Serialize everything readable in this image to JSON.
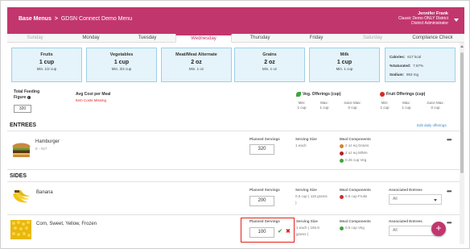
{
  "header": {
    "crumb_root": "Base Menus",
    "crumb_sep": ">",
    "crumb_current": "GDSN Connect Demo Menu",
    "user_name": "Jennifer Frank",
    "user_line2": "Classic Demo ONLY District",
    "user_line3": "District Administrator"
  },
  "tabs": [
    {
      "label": "Sunday"
    },
    {
      "label": "Monday"
    },
    {
      "label": "Tuesday"
    },
    {
      "label": "Wednesday"
    },
    {
      "label": "Thursday"
    },
    {
      "label": "Friday"
    },
    {
      "label": "Saturday"
    },
    {
      "label": "Compliance Check"
    }
  ],
  "cards": [
    {
      "title": "Fruits",
      "value": "1 cup",
      "min": "Min. 1/2 cup"
    },
    {
      "title": "Vegetables",
      "value": "1 cup",
      "min": "Min. 3/4 cup"
    },
    {
      "title": "Meat/Meat Alternate",
      "value": "2 oz",
      "min": "Min. 1 oz"
    },
    {
      "title": "Grains",
      "value": "2 oz",
      "min": "Min. 1 oz"
    },
    {
      "title": "Milk",
      "value": "1 cup",
      "min": "Min. 1 cup"
    }
  ],
  "summary": {
    "calories_label": "Calories:",
    "calories_value": "617 kcal",
    "saturated_label": "%Saturated:",
    "saturated_value": "7.67%",
    "sodium_label": "Sodium:",
    "sodium_value": "953 mg"
  },
  "feeding": {
    "label_line1": "Total Feeding",
    "label_line2": "Figure",
    "value": "320",
    "avg_cost_label": "Avg Cost per Meal",
    "cost_note": "Item Costs Missing"
  },
  "veg_offerings": {
    "title": "Veg. Offerings (cup)",
    "cols": [
      {
        "head": "Min:",
        "val": "1 cup"
      },
      {
        "head": "Max:",
        "val": "1 cup"
      },
      {
        "head": "Juice Max:",
        "val": "0 cup"
      }
    ]
  },
  "fruit_offerings": {
    "title": "Fruit Offerings (cup)",
    "cols": [
      {
        "head": "Min:",
        "val": "1 cup"
      },
      {
        "head": "Max:",
        "val": "1 cup"
      },
      {
        "head": "Juice Max:",
        "val": "0 cup"
      }
    ]
  },
  "entrees": {
    "title": "ENTREES",
    "edit_link": "Edit daily offerings",
    "items": [
      {
        "name": "Hamburger",
        "code": "E - 927",
        "planned_label": "Planned Servings",
        "planned": "320",
        "size_label": "Serving Size",
        "size": "1 each",
        "comp_label": "Meal Components",
        "components": [
          "2 oz eq Grains",
          "2 oz eq M/MA",
          "0.25 cup Veg"
        ]
      }
    ]
  },
  "sides": {
    "title": "SIDES",
    "items": [
      {
        "name": "Banana",
        "planned_label": "Planned Servings",
        "planned": "200",
        "size_label": "Serving Size",
        "size_line1": "0.5 cup ( 118 grams",
        "size_line2": ")",
        "comp_label": "Meal Components",
        "component": "0.5 cup Fruits",
        "assoc_label": "Associated Entrees",
        "assoc_value": "All"
      },
      {
        "name": "Corn, Sweet, Yellow, Frozen",
        "planned_label": "Planned Servings",
        "planned": "100",
        "size_label": "Serving Size",
        "size_line1": "1 each ( 165.9",
        "size_line2": "grams )",
        "comp_label": "Meal Components",
        "component": "0.5 cup Veg",
        "assoc_label": "Associated Entrees",
        "assoc_value": "All"
      }
    ]
  },
  "icons": {
    "info": "i",
    "more": "•••",
    "check": "✔",
    "close": "✖",
    "add": "+"
  },
  "colors": {
    "brand": "#c2366e",
    "card_bg": "#e5f3fa",
    "card_border": "#9fd0e6",
    "warning": "#d9261c",
    "link": "#3a8bc9",
    "grains": "#d9822b",
    "meat": "#b3202a",
    "veg": "#3fa53f",
    "fruit": "#d42b2b"
  }
}
